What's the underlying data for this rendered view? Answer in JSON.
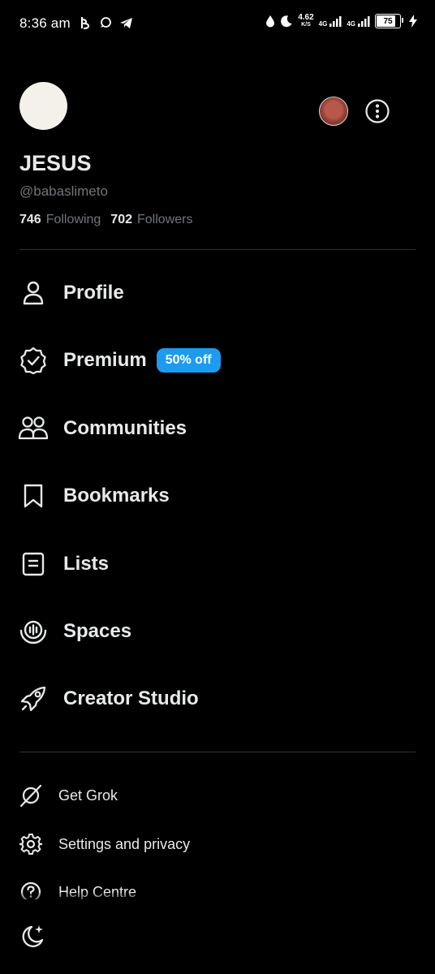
{
  "status_bar": {
    "time": "8:36 am",
    "net_speed_value": "4.62",
    "net_speed_unit": "K/S",
    "net_label_1": "4G",
    "net_label_2": "4G",
    "battery_level": "75",
    "battery_fraction": 0.75
  },
  "profile": {
    "name": "JESUS",
    "handle": "@babaslimeto",
    "following_count": "746",
    "following_label": "Following",
    "followers_count": "702",
    "followers_label": "Followers"
  },
  "nav": {
    "items": [
      {
        "label": "Profile",
        "icon": "person-icon"
      },
      {
        "label": "Premium",
        "icon": "verified-badge-icon",
        "badge": "50% off"
      },
      {
        "label": "Communities",
        "icon": "communities-icon"
      },
      {
        "label": "Bookmarks",
        "icon": "bookmark-icon"
      },
      {
        "label": "Lists",
        "icon": "list-icon"
      },
      {
        "label": "Spaces",
        "icon": "spaces-icon"
      },
      {
        "label": "Creator Studio",
        "icon": "rocket-icon"
      }
    ]
  },
  "secondary": {
    "items": [
      {
        "label": "Get Grok",
        "icon": "grok-icon"
      },
      {
        "label": "Settings and privacy",
        "icon": "gear-icon"
      },
      {
        "label": "Help Centre",
        "icon": "help-icon"
      }
    ]
  },
  "colors": {
    "background": "#000000",
    "text": "#e7e9ea",
    "muted": "#71767b",
    "divider": "#2f3336",
    "accent": "#1d9bf0"
  }
}
